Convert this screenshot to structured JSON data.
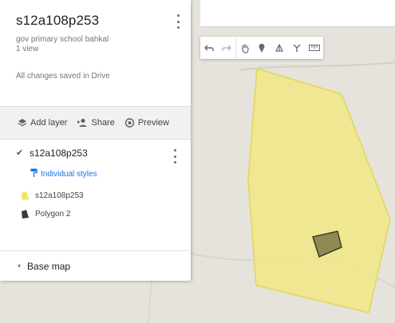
{
  "colors": {
    "polygon_fill": "#f0e784",
    "polygon_stroke": "#e2d55a",
    "inner_fill": "#8e8a53",
    "inner_stroke": "#3f3d22",
    "link": "#1a73e8"
  },
  "panel": {
    "title": "s12a108p253",
    "description": "gov primary school bahkal",
    "views": "1 view",
    "status": "All changes saved in Drive",
    "menu_icon": "more-vert-icon"
  },
  "actions": [
    {
      "label": "Add layer",
      "icon": "add-layer-icon"
    },
    {
      "label": "Share",
      "icon": "add-person-icon"
    },
    {
      "label": "Preview",
      "icon": "eye-icon"
    }
  ],
  "layer": {
    "name": "s12a108p253",
    "checked": true,
    "styles_label": "Individual styles",
    "features": [
      {
        "label": "s12a108p253",
        "color": "#f0e65f"
      },
      {
        "label": "Polygon 2",
        "color": "#3d3b30"
      }
    ]
  },
  "basemap": {
    "label": "Base map"
  },
  "toolbar": [
    {
      "name": "undo-icon",
      "enabled": true
    },
    {
      "name": "redo-icon",
      "enabled": false
    },
    {
      "name": "pan-hand-icon",
      "enabled": true
    },
    {
      "name": "add-marker-icon",
      "enabled": true
    },
    {
      "name": "draw-line-icon",
      "enabled": true
    },
    {
      "name": "directions-icon",
      "enabled": true
    },
    {
      "name": "ruler-icon",
      "enabled": true
    }
  ]
}
